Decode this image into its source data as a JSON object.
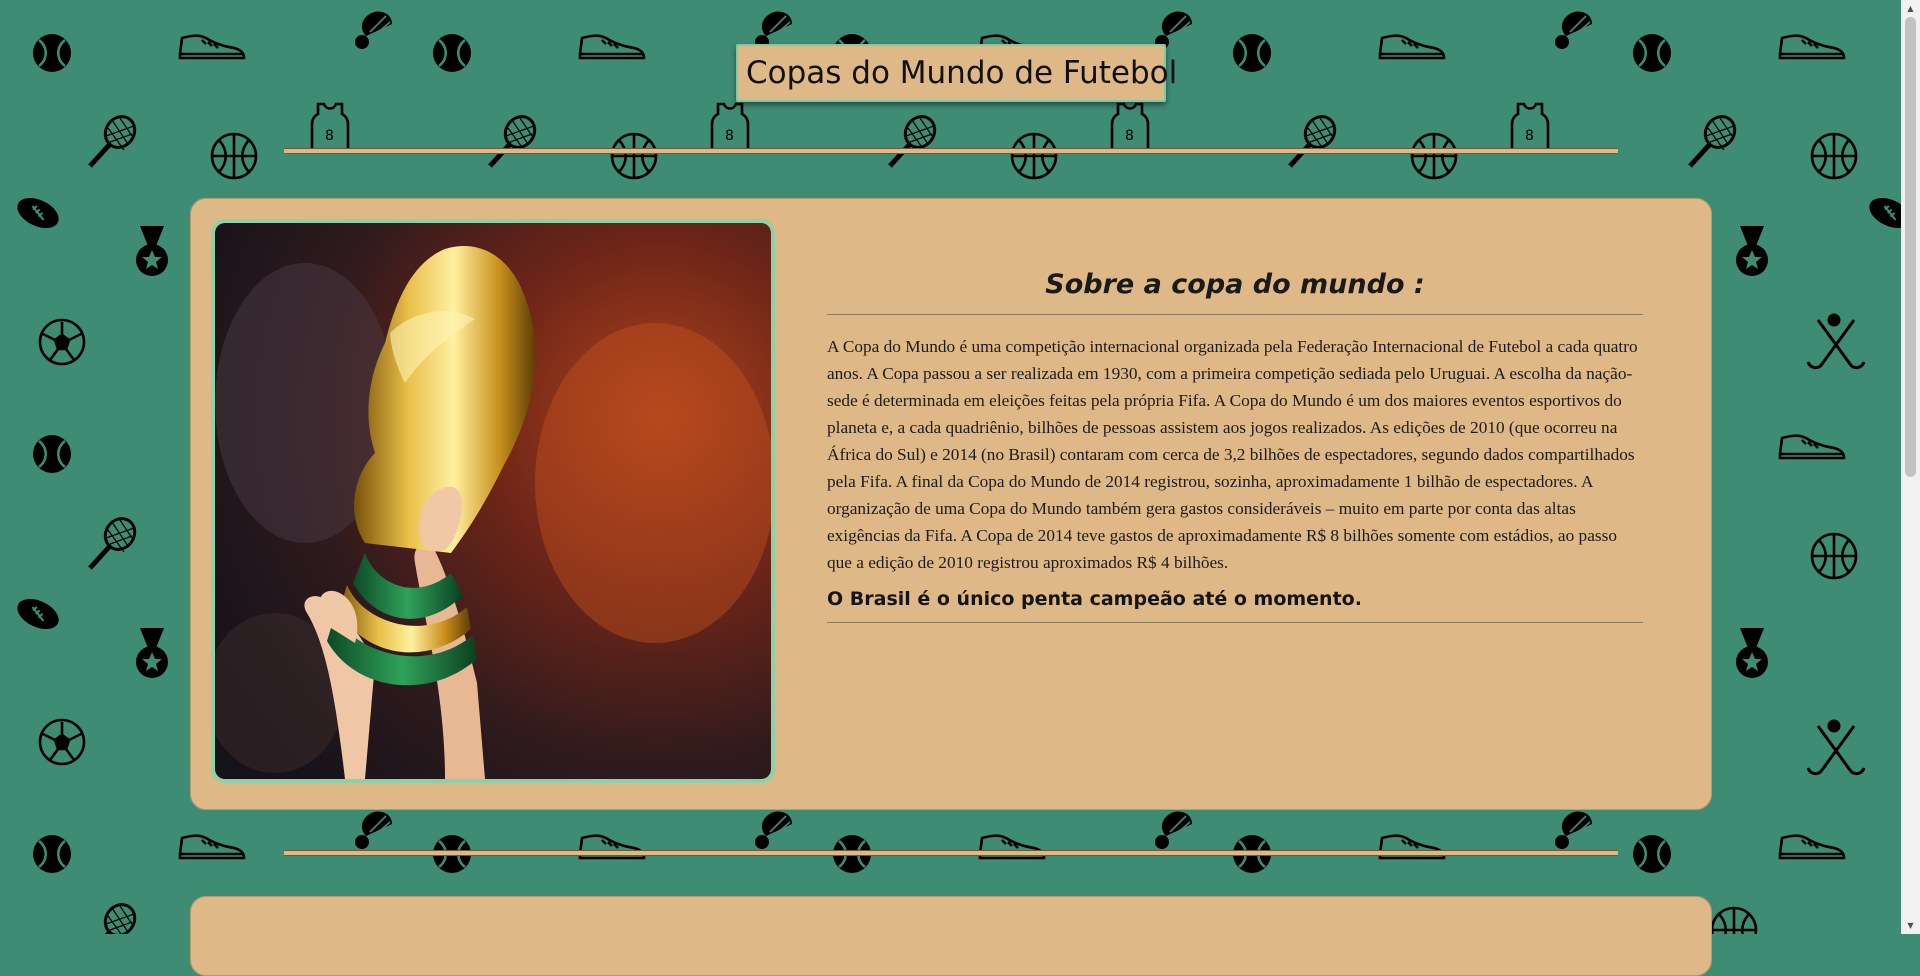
{
  "header": {
    "title": "Copas do Mundo de Futebol"
  },
  "about": {
    "image_alt": "Taça da Copa do Mundo erguida",
    "heading": "Sobre a copa do mundo :",
    "body": "A Copa do Mundo é uma competição internacional organizada pela Federação Internacional de Futebol a cada quatro anos. A Copa passou a ser realizada em 1930, com a primeira competição sediada pelo Uruguai. A escolha da nação-sede é determinada em eleições feitas pela própria Fifa. A Copa do Mundo é um dos maiores eventos esportivos do planeta e, a cada quadriênio, bilhões de pessoas assistem aos jogos realizados. As edições de 2010 (que ocorreu na África do Sul) e 2014 (no Brasil) contaram com cerca de 3,2 bilhões de espectadores, segundo dados compartilhados pela Fifa. A final da Copa do Mundo de 2014 registrou, sozinha, aproximadamente 1 bilhão de espectadores. A organização de uma Copa do Mundo também gera gastos consideráveis – muito em parte por conta das altas exigências da Fifa. A Copa de 2014 teve gastos de aproximadamente R$ 8 bilhões somente com estádios, ao passo que a edição de 2010 registrou aproximados R$ 4 bilhões.",
    "highlight": "O Brasil é o único penta campeão até o momento."
  },
  "colors": {
    "background": "#3f8c74",
    "card": "#deb887",
    "frame_border": "#8fd1a6",
    "pattern_icons": "#000000"
  },
  "pattern_icons": [
    "tennis-ball-icon",
    "sneaker-icon",
    "shuttlecock-icon",
    "tennis-racket-icon",
    "jersey-icon",
    "basketball-icon",
    "football-icon",
    "medal-icon",
    "soccer-ball-icon",
    "hockey-stick-icon"
  ]
}
